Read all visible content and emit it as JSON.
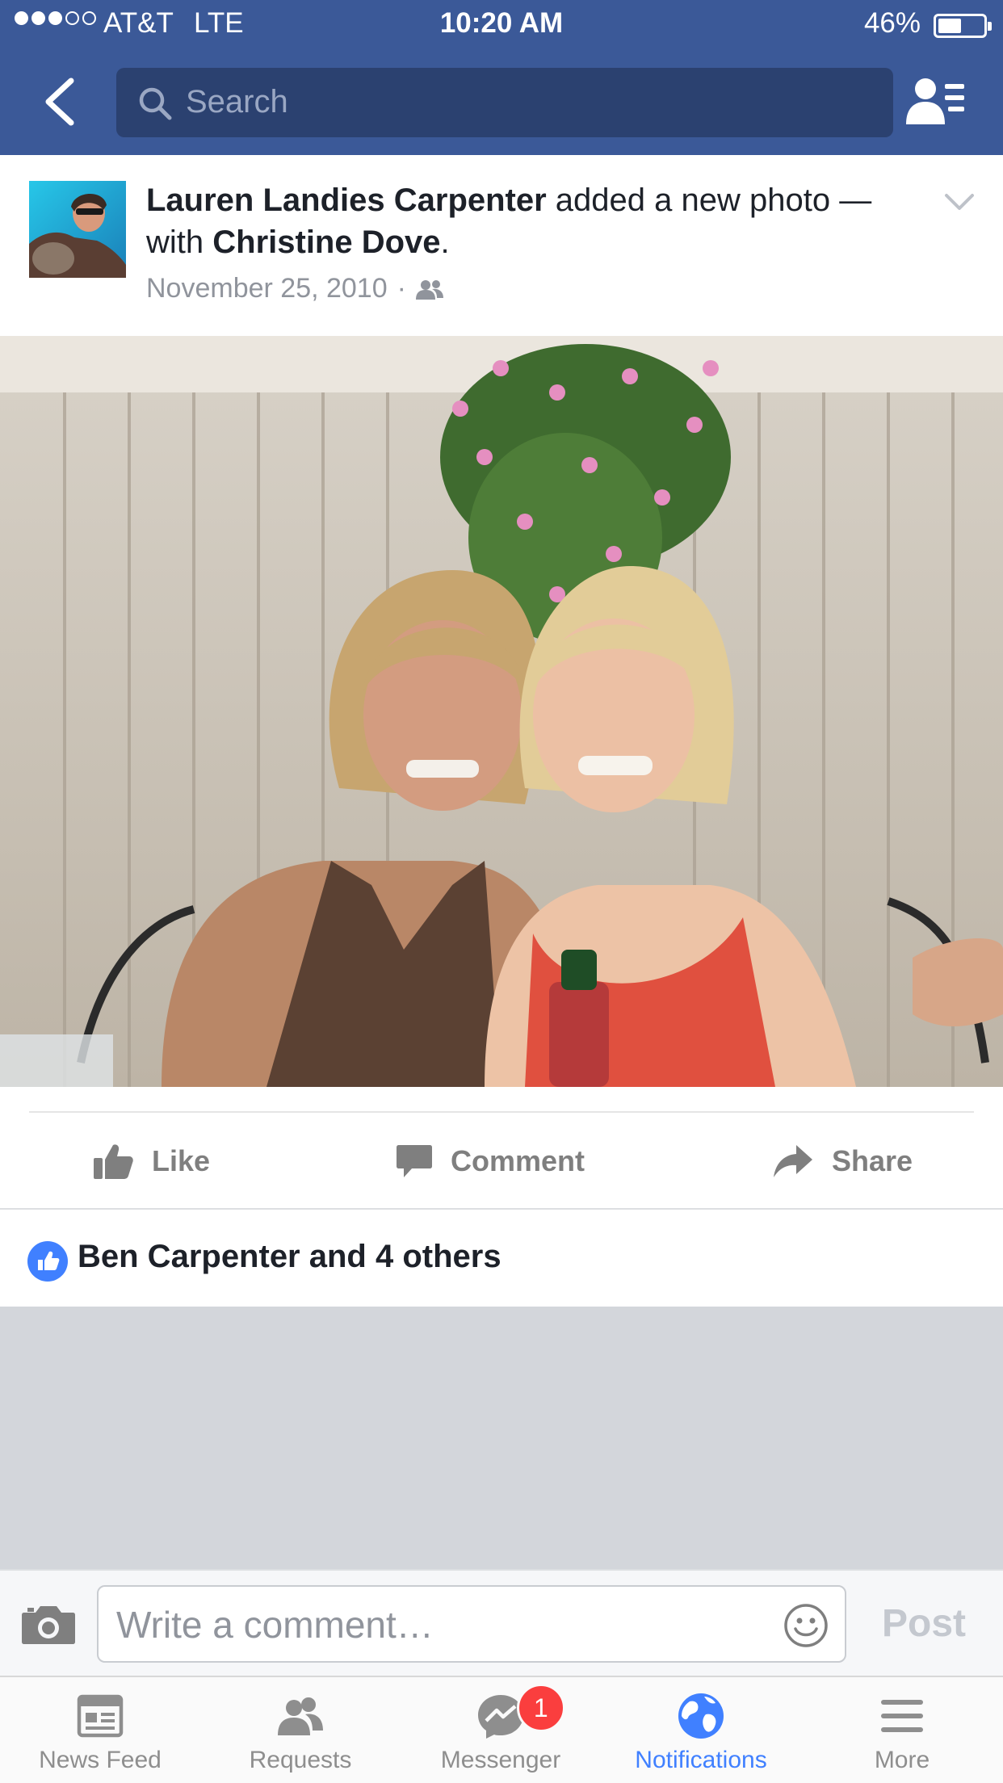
{
  "status_bar": {
    "carrier": "AT&T",
    "network": "LTE",
    "time": "10:20 AM",
    "battery_percent": "46%",
    "signal_bars_filled": 3,
    "signal_bars_total": 5,
    "battery_level": 0.46
  },
  "header": {
    "search_placeholder": "Search",
    "back_icon": "chevron-left-icon",
    "friends_icon": "friend-requests-icon"
  },
  "post": {
    "author": "Lauren Landies Carpenter",
    "action_text": " added a new photo — with ",
    "tagged": "Christine Dove",
    "tail": ".",
    "date": "November 25, 2010",
    "separator": "·",
    "audience_icon": "friends-audience-icon"
  },
  "actions": {
    "like": "Like",
    "comment": "Comment",
    "share": "Share"
  },
  "likes_summary": "Ben Carpenter and 4 others",
  "composer": {
    "placeholder": "Write a comment…",
    "post_label": "Post"
  },
  "tabs": [
    {
      "label": "News Feed",
      "icon": "news-feed-icon",
      "active": false
    },
    {
      "label": "Requests",
      "icon": "requests-icon",
      "active": false
    },
    {
      "label": "Messenger",
      "icon": "messenger-icon",
      "active": false,
      "badge": "1"
    },
    {
      "label": "Notifications",
      "icon": "globe-icon",
      "active": true
    },
    {
      "label": "More",
      "icon": "menu-icon",
      "active": false
    }
  ],
  "colors": {
    "brand": "#3b5998",
    "accent": "#4080ff",
    "badge": "#fa3e3e"
  }
}
